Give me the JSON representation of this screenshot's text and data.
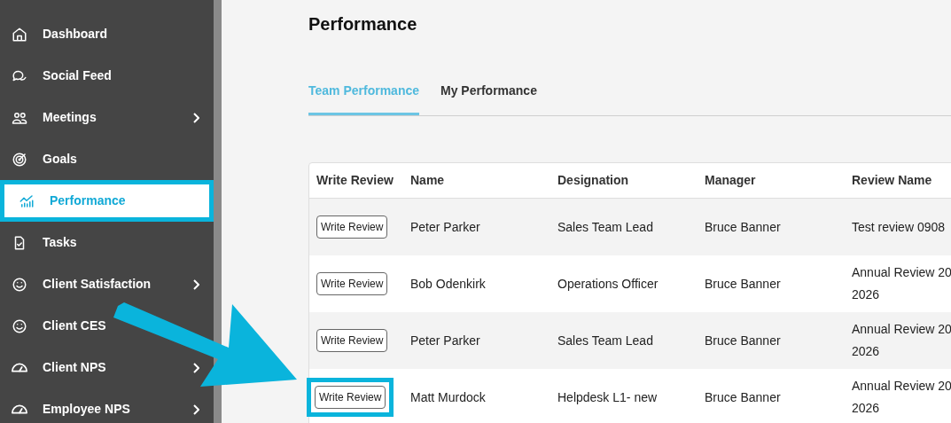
{
  "sidebar": {
    "items": [
      {
        "label": "Dashboard",
        "selected": false,
        "highlighted": false,
        "submenu": false
      },
      {
        "label": "Social Feed",
        "selected": false,
        "highlighted": false,
        "submenu": false
      },
      {
        "label": "Meetings",
        "selected": false,
        "highlighted": false,
        "submenu": true
      },
      {
        "label": "Goals",
        "selected": false,
        "highlighted": false,
        "submenu": false
      },
      {
        "label": "Performance",
        "selected": true,
        "highlighted": true,
        "submenu": false
      },
      {
        "label": "Tasks",
        "selected": false,
        "highlighted": false,
        "submenu": false
      },
      {
        "label": "Client Satisfaction",
        "selected": false,
        "highlighted": false,
        "submenu": true
      },
      {
        "label": "Client CES",
        "selected": false,
        "highlighted": false,
        "submenu": false
      },
      {
        "label": "Client NPS",
        "selected": false,
        "highlighted": false,
        "submenu": true
      },
      {
        "label": "Employee NPS",
        "selected": false,
        "highlighted": false,
        "submenu": true
      }
    ]
  },
  "page": {
    "title": "Performance"
  },
  "tabs": [
    {
      "label": "Team Performance",
      "selected": true
    },
    {
      "label": "My Performance",
      "selected": false
    }
  ],
  "table": {
    "columns": [
      "Write Review",
      "Name",
      "Designation",
      "Manager",
      "Review Name"
    ],
    "rows": [
      {
        "button": "Write Review",
        "highlighted": false,
        "name": "Peter Parker",
        "designation": "Sales Team Lead",
        "manager": "Bruce Banner",
        "review_name": [
          "Test review 0908"
        ]
      },
      {
        "button": "Write Review",
        "highlighted": false,
        "name": "Bob Odenkirk",
        "designation": "Operations Officer",
        "manager": "Bruce Banner",
        "review_name": [
          "Annual Review 20",
          "2026"
        ]
      },
      {
        "button": "Write Review",
        "highlighted": false,
        "name": "Peter Parker",
        "designation": "Sales Team Lead",
        "manager": "Bruce Banner",
        "review_name": [
          "Annual Review 20",
          "2026"
        ]
      },
      {
        "button": "Write Review",
        "highlighted": true,
        "name": "Matt Murdock",
        "designation": "Helpdesk L1- new",
        "manager": "Bruce Banner",
        "review_name": [
          "Annual Review 20",
          "2026"
        ]
      }
    ]
  },
  "annotation": {
    "arrow": true
  }
}
